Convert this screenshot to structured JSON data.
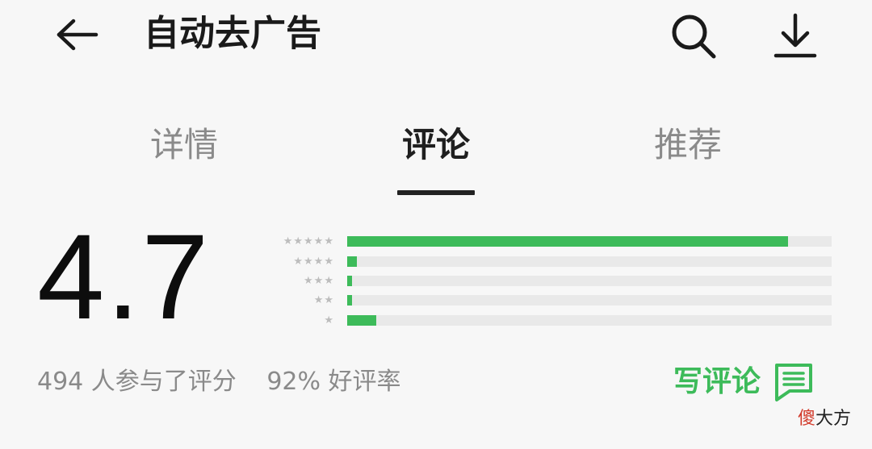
{
  "header": {
    "title": "自动去广告",
    "back_icon": "arrow-left-icon",
    "search_icon": "search-icon",
    "download_icon": "download-icon"
  },
  "tabs": [
    {
      "label": "详情",
      "active": false
    },
    {
      "label": "评论",
      "active": true
    },
    {
      "label": "推荐",
      "active": false
    }
  ],
  "rating": {
    "score": "4.7",
    "distribution": [
      {
        "stars": "★★★★★",
        "fraction": 0.91
      },
      {
        "stars": "★★★★",
        "fraction": 0.02
      },
      {
        "stars": "★★★",
        "fraction": 0.01
      },
      {
        "stars": "★★",
        "fraction": 0.01
      },
      {
        "stars": "★",
        "fraction": 0.06
      }
    ],
    "count_text": "494 人参与了评分",
    "positive_text": "92% 好评率"
  },
  "actions": {
    "write_review_label": "写评论",
    "write_review_icon": "comment-icon"
  },
  "watermark": {
    "first": "傻",
    "rest": "大方"
  },
  "colors": {
    "accent": "#3dbb5a",
    "track": "#e9e9e9",
    "background": "#f7f7f7"
  }
}
